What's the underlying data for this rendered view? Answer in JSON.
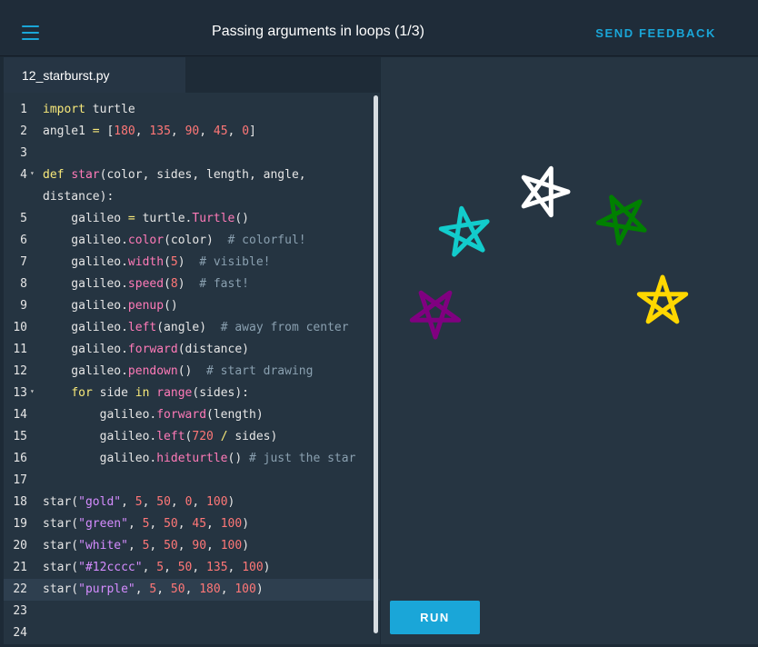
{
  "header": {
    "title": "Passing arguments in loops (1/3)",
    "feedback_label": "SEND FEEDBACK"
  },
  "editor": {
    "filename": "12_starburst.py",
    "lines": [
      {
        "n": "1",
        "code": "<span class=\"kw\">import</span> turtle"
      },
      {
        "n": "2",
        "code": "angle1 <span class=\"kw\">=</span> [<span class=\"num\">180</span>, <span class=\"num\">135</span>, <span class=\"num\">90</span>, <span class=\"num\">45</span>, <span class=\"num\">0</span>]"
      },
      {
        "n": "3",
        "code": ""
      },
      {
        "n": "4",
        "fold": true,
        "code": "<span class=\"kw\">def</span> <span class=\"fn\">star</span>(color, sides, length, angle,"
      },
      {
        "n": "",
        "code": "distance):"
      },
      {
        "n": "5",
        "code": "    galileo <span class=\"kw\">=</span> turtle.<span class=\"fn\">Turtle</span>()"
      },
      {
        "n": "6",
        "code": "    galileo.<span class=\"fn\">color</span>(color)  <span class=\"cm\"># colorful!</span>"
      },
      {
        "n": "7",
        "code": "    galileo.<span class=\"fn\">width</span>(<span class=\"num\">5</span>)  <span class=\"cm\"># visible!</span>"
      },
      {
        "n": "8",
        "code": "    galileo.<span class=\"fn\">speed</span>(<span class=\"num\">8</span>)  <span class=\"cm\"># fast!</span>"
      },
      {
        "n": "9",
        "code": "    galileo.<span class=\"fn\">penup</span>()"
      },
      {
        "n": "10",
        "code": "    galileo.<span class=\"fn\">left</span>(angle)  <span class=\"cm\"># away from center</span>"
      },
      {
        "n": "11",
        "code": "    galileo.<span class=\"fn\">forward</span>(distance)"
      },
      {
        "n": "12",
        "code": "    galileo.<span class=\"fn\">pendown</span>()  <span class=\"cm\"># start drawing</span>"
      },
      {
        "n": "13",
        "fold": true,
        "code": "    <span class=\"kw\">for</span> side <span class=\"kw\">in</span> <span class=\"fn\">range</span>(sides):"
      },
      {
        "n": "14",
        "code": "        galileo.<span class=\"fn\">forward</span>(length)"
      },
      {
        "n": "15",
        "code": "        galileo.<span class=\"fn\">left</span>(<span class=\"num\">720</span> <span class=\"kw\">/</span> sides)"
      },
      {
        "n": "16",
        "code": "        galileo.<span class=\"fn\">hideturtle</span>() <span class=\"cm\"># just the star</span>"
      },
      {
        "n": "17",
        "code": ""
      },
      {
        "n": "18",
        "code": "star(<span class=\"str\">\"gold\"</span>, <span class=\"num\">5</span>, <span class=\"num\">50</span>, <span class=\"num\">0</span>, <span class=\"num\">100</span>)"
      },
      {
        "n": "19",
        "code": "star(<span class=\"str\">\"green\"</span>, <span class=\"num\">5</span>, <span class=\"num\">50</span>, <span class=\"num\">45</span>, <span class=\"num\">100</span>)"
      },
      {
        "n": "20",
        "code": "star(<span class=\"str\">\"white\"</span>, <span class=\"num\">5</span>, <span class=\"num\">50</span>, <span class=\"num\">90</span>, <span class=\"num\">100</span>)"
      },
      {
        "n": "21",
        "code": "star(<span class=\"str\">\"#12cccc\"</span>, <span class=\"num\">5</span>, <span class=\"num\">50</span>, <span class=\"num\">135</span>, <span class=\"num\">100</span>)"
      },
      {
        "n": "22",
        "active": true,
        "code": "star(<span class=\"str\">\"purple\"</span>, <span class=\"num\">5</span>, <span class=\"num\">50</span>, <span class=\"num\">180</span>, <span class=\"num\">100</span>)"
      },
      {
        "n": "23",
        "code": ""
      },
      {
        "n": "24",
        "code": ""
      }
    ]
  },
  "output": {
    "run_label": "RUN",
    "stars": [
      {
        "color": "#ffd700"
      },
      {
        "color": "#008000"
      },
      {
        "color": "#ffffff"
      },
      {
        "color": "#12cccc"
      },
      {
        "color": "#800080"
      }
    ]
  },
  "colors": {
    "accent": "#1aa6d8",
    "background": "#1d2a36"
  },
  "icons": {
    "menu": "hamburger-menu-icon",
    "fold": "fold-triangle-icon"
  }
}
